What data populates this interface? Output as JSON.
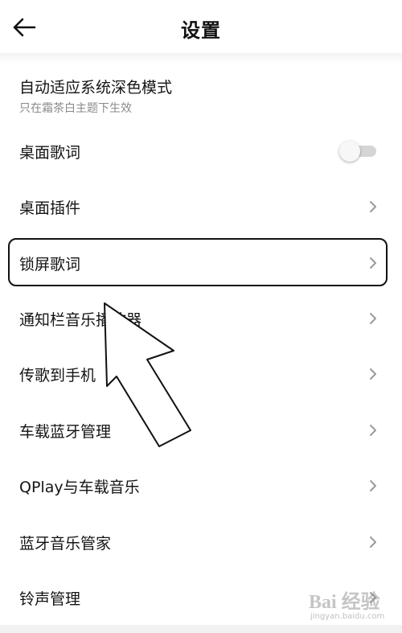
{
  "header": {
    "title": "设置",
    "back_icon": "arrow-left-icon"
  },
  "settings": {
    "dark_mode": {
      "label": "自动适应系统深色模式",
      "sublabel": "只在霜茶白主题下生效"
    },
    "desktop_lyrics": {
      "label": "桌面歌词",
      "toggle_on": false
    },
    "items": [
      {
        "label": "桌面插件"
      },
      {
        "label": "锁屏歌词"
      },
      {
        "label": "通知栏音乐播放器"
      },
      {
        "label": "传歌到手机"
      },
      {
        "label": "车载蓝牙管理"
      },
      {
        "label": "QPlay与车载音乐"
      },
      {
        "label": "蓝牙音乐管家"
      },
      {
        "label": "铃声管理"
      }
    ]
  },
  "watermark": {
    "text": "Bai 经验",
    "sub": "jingyan.baidu.com"
  },
  "colors": {
    "text": "#141414",
    "subtext": "#8a8a8a",
    "chevron": "#9a9a9a",
    "toggle_track": "#d5d5d5"
  }
}
